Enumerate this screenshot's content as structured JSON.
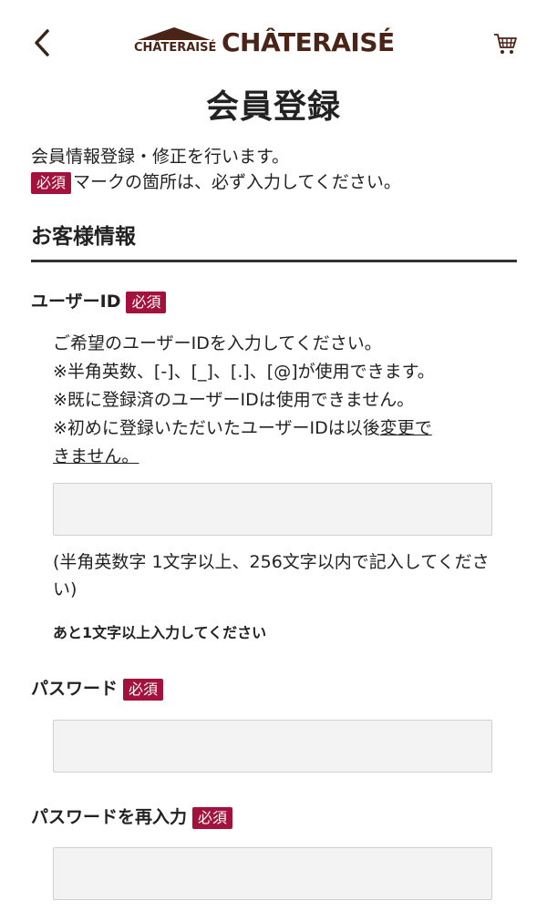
{
  "header": {
    "logo_small": "CHÂTERAISÉ",
    "logo_big": "CHÂTERAISÉ"
  },
  "page_title": "会員登録",
  "intro": {
    "line1": "会員情報登録・修正を行います。",
    "badge": "必須",
    "line2": "マークの箇所は、必ず入力してください。"
  },
  "section_title": "お客様情報",
  "fields": {
    "user_id": {
      "label": "ユーザーID",
      "badge": "必須",
      "notes": [
        "ご希望のユーザーIDを入力してください。",
        "※半角英数、[-]、[_]、[.]、[@]が使用できます。",
        "※既に登録済のユーザーIDは使用できません。"
      ],
      "note4_prefix": "※初めに登録いただいたユーザーIDは以後",
      "note4_link1": "変更で",
      "note4_link2": "きません。",
      "value": "",
      "hint": "(半角英数字 1文字以上、256文字以内で記入してください)",
      "remaining": "あと1文字以上入力してください"
    },
    "password": {
      "label": "パスワード",
      "badge": "必須",
      "value": ""
    },
    "password_confirm": {
      "label": "パスワードを再入力",
      "badge": "必須",
      "value": ""
    }
  },
  "colors": {
    "brand": "#4a2416",
    "badge": "#a3123d",
    "input_bg": "#f3f3f3"
  }
}
